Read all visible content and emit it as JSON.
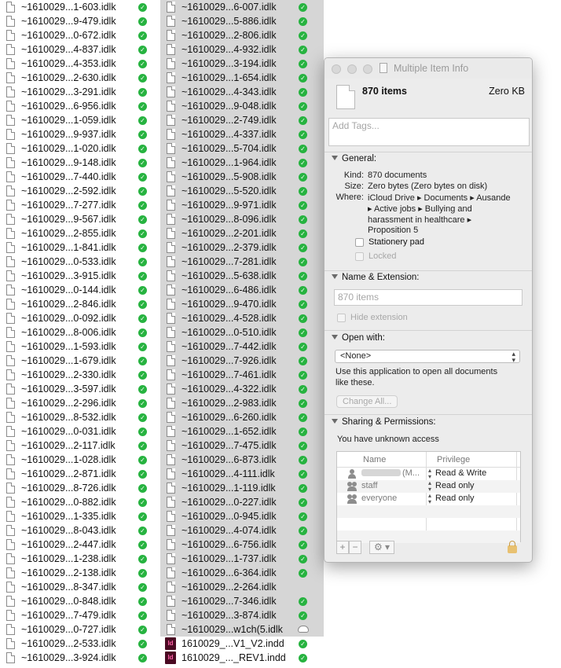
{
  "left_files": [
    "~1610029...1-603.idlk",
    "~1610029...9-479.idlk",
    "~1610029...0-672.idlk",
    "~1610029...4-837.idlk",
    "~1610029...4-353.idlk",
    "~1610029...2-630.idlk",
    "~1610029...3-291.idlk",
    "~1610029...6-956.idlk",
    "~1610029...1-059.idlk",
    "~1610029...9-937.idlk",
    "~1610029...1-020.idlk",
    "~1610029...9-148.idlk",
    "~1610029...7-440.idlk",
    "~1610029...2-592.idlk",
    "~1610029...7-277.idlk",
    "~1610029...9-567.idlk",
    "~1610029...2-855.idlk",
    "~1610029...1-841.idlk",
    "~1610029...0-533.idlk",
    "~1610029...3-915.idlk",
    "~1610029...0-144.idlk",
    "~1610029...2-846.idlk",
    "~1610029...0-092.idlk",
    "~1610029...8-006.idlk",
    "~1610029...1-593.idlk",
    "~1610029...1-679.idlk",
    "~1610029...2-330.idlk",
    "~1610029...3-597.idlk",
    "~1610029...2-296.idlk",
    "~1610029...8-532.idlk",
    "~1610029...0-031.idlk",
    "~1610029...2-117.idlk",
    "~1610029...1-028.idlk",
    "~1610029...2-871.idlk",
    "~1610029...8-726.idlk",
    "~1610029...0-882.idlk",
    "~1610029...1-335.idlk",
    "~1610029...8-043.idlk",
    "~1610029...2-447.idlk",
    "~1610029...1-238.idlk",
    "~1610029...2-138.idlk",
    "~1610029...8-347.idlk",
    "~1610029...0-848.idlk",
    "~1610029...7-479.idlk",
    "~1610029...0-727.idlk",
    "~1610029...2-533.idlk",
    "~1610029...3-924.idlk"
  ],
  "right_files": [
    {
      "name": "~1610029...6-007.idlk",
      "status": "synced"
    },
    {
      "name": "~1610029...5-886.idlk",
      "status": "synced"
    },
    {
      "name": "~1610029...2-806.idlk",
      "status": "synced"
    },
    {
      "name": "~1610029...4-932.idlk",
      "status": "synced"
    },
    {
      "name": "~1610029...3-194.idlk",
      "status": "synced"
    },
    {
      "name": "~1610029...1-654.idlk",
      "status": "synced"
    },
    {
      "name": "~1610029...4-343.idlk",
      "status": "synced"
    },
    {
      "name": "~1610029...9-048.idlk",
      "status": "synced"
    },
    {
      "name": "~1610029...2-749.idlk",
      "status": "synced"
    },
    {
      "name": "~1610029...4-337.idlk",
      "status": "synced"
    },
    {
      "name": "~1610029...5-704.idlk",
      "status": "synced"
    },
    {
      "name": "~1610029...1-964.idlk",
      "status": "synced"
    },
    {
      "name": "~1610029...5-908.idlk",
      "status": "synced"
    },
    {
      "name": "~1610029...5-520.idlk",
      "status": "synced"
    },
    {
      "name": "~1610029...9-971.idlk",
      "status": "synced"
    },
    {
      "name": "~1610029...8-096.idlk",
      "status": "synced"
    },
    {
      "name": "~1610029...2-201.idlk",
      "status": "synced"
    },
    {
      "name": "~1610029...2-379.idlk",
      "status": "synced"
    },
    {
      "name": "~1610029...7-281.idlk",
      "status": "synced"
    },
    {
      "name": "~1610029...5-638.idlk",
      "status": "synced"
    },
    {
      "name": "~1610029...6-486.idlk",
      "status": "synced"
    },
    {
      "name": "~1610029...9-470.idlk",
      "status": "synced"
    },
    {
      "name": "~1610029...4-528.idlk",
      "status": "synced"
    },
    {
      "name": "~1610029...0-510.idlk",
      "status": "synced"
    },
    {
      "name": "~1610029...7-442.idlk",
      "status": "synced"
    },
    {
      "name": "~1610029...7-926.idlk",
      "status": "synced"
    },
    {
      "name": "~1610029...7-461.idlk",
      "status": "synced"
    },
    {
      "name": "~1610029...4-322.idlk",
      "status": "synced"
    },
    {
      "name": "~1610029...2-983.idlk",
      "status": "synced"
    },
    {
      "name": "~1610029...6-260.idlk",
      "status": "synced"
    },
    {
      "name": "~1610029...1-652.idlk",
      "status": "synced"
    },
    {
      "name": "~1610029...7-475.idlk",
      "status": "synced"
    },
    {
      "name": "~1610029...6-873.idlk",
      "status": "synced"
    },
    {
      "name": "~1610029...4-111.idlk",
      "status": "synced"
    },
    {
      "name": "~1610029...1-119.idlk",
      "status": "synced"
    },
    {
      "name": "~1610029...0-227.idlk",
      "status": "synced"
    },
    {
      "name": "~1610029...0-945.idlk",
      "status": "synced"
    },
    {
      "name": "~1610029...4-074.idlk",
      "status": "synced"
    },
    {
      "name": "~1610029...6-756.idlk",
      "status": "synced"
    },
    {
      "name": "~1610029...1-737.idlk",
      "status": "synced"
    },
    {
      "name": "~1610029...6-364.idlk",
      "status": "synced"
    },
    {
      "name": "~1610029...2-264.idlk",
      "status": "none"
    },
    {
      "name": "~1610029...7-346.idlk",
      "status": "synced"
    },
    {
      "name": "~1610029...3-874.idlk",
      "status": "synced"
    },
    {
      "name": "~1610029...w1ch(5.idlk",
      "status": "cloud"
    },
    {
      "name": "1610029_...V1_V2.indd",
      "status": "synced",
      "type": "indd"
    },
    {
      "name": "1610029_..._REV1.indd",
      "status": "synced",
      "type": "indd"
    }
  ],
  "info": {
    "window_title": "Multiple Item Info",
    "item_count": "870 items",
    "total_size": "Zero KB",
    "tags_placeholder": "Add Tags...",
    "general": {
      "header": "General:",
      "kind_label": "Kind:",
      "kind": "870 documents",
      "size_label": "Size:",
      "size": "Zero bytes (Zero bytes on disk)",
      "where_label": "Where:",
      "where_lines": [
        "iCloud Drive ▸ Documents ▸ Ausande",
        "▸ Active jobs ▸ Bullying and",
        "harassment in healthcare ▸",
        "Proposition 5"
      ],
      "stationery": "Stationery pad",
      "locked": "Locked"
    },
    "name_ext": {
      "header": "Name & Extension:",
      "placeholder": "870 items",
      "hide_ext": "Hide extension"
    },
    "open_with": {
      "header": "Open with:",
      "selected": "<None>",
      "note_lines": [
        "Use this application to open all documents",
        "like these."
      ],
      "change_all": "Change All..."
    },
    "sharing": {
      "header": "Sharing & Permissions:",
      "access": "You have unknown access",
      "col_name": "Name",
      "col_priv": "Privilege",
      "rows": [
        {
          "name": "(M...",
          "privilege": "Read & Write",
          "icon": "user-icon"
        },
        {
          "name": "staff",
          "privilege": "Read only",
          "icon": "group-icon"
        },
        {
          "name": "everyone",
          "privilege": "Read only",
          "icon": "group-icon"
        }
      ],
      "add": "+",
      "remove": "−",
      "action": "⚙"
    }
  }
}
